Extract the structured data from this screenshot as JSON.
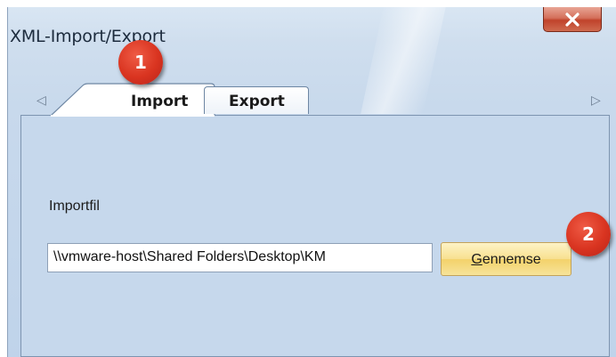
{
  "window": {
    "title": "XML-Import/Export",
    "close_icon": "close-icon"
  },
  "tabs": [
    {
      "label": "Import",
      "selected": true
    },
    {
      "label": "Export",
      "selected": false
    }
  ],
  "tab_nav": {
    "prev_icon": "triangle-left-icon",
    "next_icon": "triangle-right-icon"
  },
  "import_panel": {
    "field_label": "Importfil",
    "path_value": "\\\\vmware-host\\Shared Folders\\Desktop\\KM",
    "browse_label_access_key": "G",
    "browse_label_rest": "ennemse"
  },
  "callouts": [
    {
      "label": "1"
    },
    {
      "label": "2"
    }
  ],
  "colors": {
    "callout": "#d93420",
    "browse_button": "#f8e08f",
    "close_button": "#c0432b"
  }
}
